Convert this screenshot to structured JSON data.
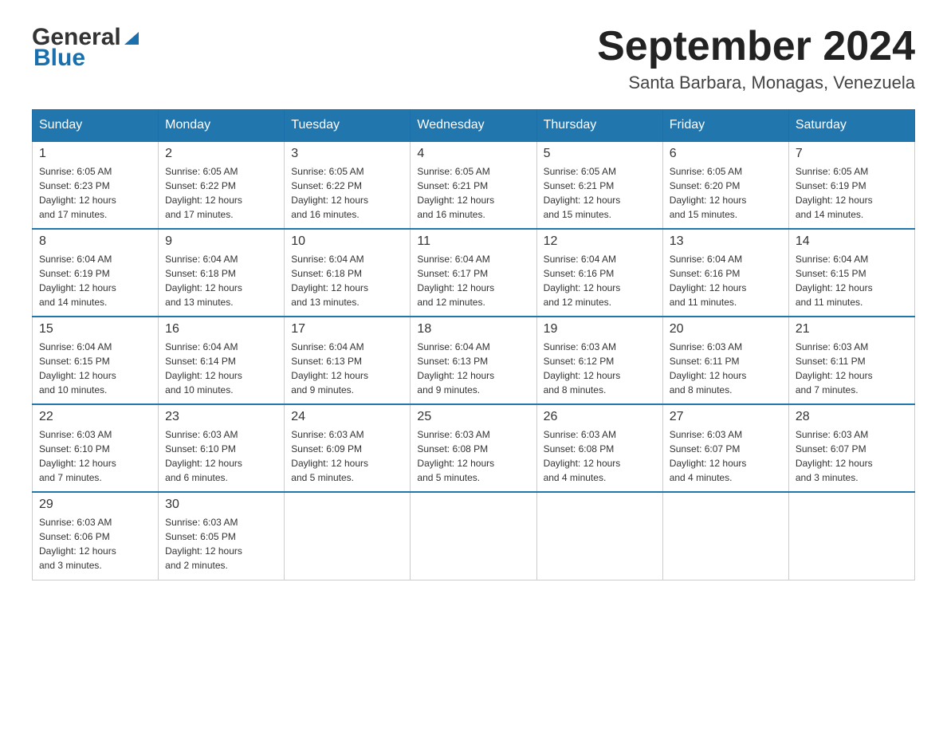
{
  "header": {
    "logo_general": "General",
    "logo_blue": "Blue",
    "title": "September 2024",
    "subtitle": "Santa Barbara, Monagas, Venezuela"
  },
  "days_of_week": [
    "Sunday",
    "Monday",
    "Tuesday",
    "Wednesday",
    "Thursday",
    "Friday",
    "Saturday"
  ],
  "weeks": [
    [
      {
        "day": "1",
        "sunrise": "6:05 AM",
        "sunset": "6:23 PM",
        "daylight": "12 hours and 17 minutes."
      },
      {
        "day": "2",
        "sunrise": "6:05 AM",
        "sunset": "6:22 PM",
        "daylight": "12 hours and 17 minutes."
      },
      {
        "day": "3",
        "sunrise": "6:05 AM",
        "sunset": "6:22 PM",
        "daylight": "12 hours and 16 minutes."
      },
      {
        "day": "4",
        "sunrise": "6:05 AM",
        "sunset": "6:21 PM",
        "daylight": "12 hours and 16 minutes."
      },
      {
        "day": "5",
        "sunrise": "6:05 AM",
        "sunset": "6:21 PM",
        "daylight": "12 hours and 15 minutes."
      },
      {
        "day": "6",
        "sunrise": "6:05 AM",
        "sunset": "6:20 PM",
        "daylight": "12 hours and 15 minutes."
      },
      {
        "day": "7",
        "sunrise": "6:05 AM",
        "sunset": "6:19 PM",
        "daylight": "12 hours and 14 minutes."
      }
    ],
    [
      {
        "day": "8",
        "sunrise": "6:04 AM",
        "sunset": "6:19 PM",
        "daylight": "12 hours and 14 minutes."
      },
      {
        "day": "9",
        "sunrise": "6:04 AM",
        "sunset": "6:18 PM",
        "daylight": "12 hours and 13 minutes."
      },
      {
        "day": "10",
        "sunrise": "6:04 AM",
        "sunset": "6:18 PM",
        "daylight": "12 hours and 13 minutes."
      },
      {
        "day": "11",
        "sunrise": "6:04 AM",
        "sunset": "6:17 PM",
        "daylight": "12 hours and 12 minutes."
      },
      {
        "day": "12",
        "sunrise": "6:04 AM",
        "sunset": "6:16 PM",
        "daylight": "12 hours and 12 minutes."
      },
      {
        "day": "13",
        "sunrise": "6:04 AM",
        "sunset": "6:16 PM",
        "daylight": "12 hours and 11 minutes."
      },
      {
        "day": "14",
        "sunrise": "6:04 AM",
        "sunset": "6:15 PM",
        "daylight": "12 hours and 11 minutes."
      }
    ],
    [
      {
        "day": "15",
        "sunrise": "6:04 AM",
        "sunset": "6:15 PM",
        "daylight": "12 hours and 10 minutes."
      },
      {
        "day": "16",
        "sunrise": "6:04 AM",
        "sunset": "6:14 PM",
        "daylight": "12 hours and 10 minutes."
      },
      {
        "day": "17",
        "sunrise": "6:04 AM",
        "sunset": "6:13 PM",
        "daylight": "12 hours and 9 minutes."
      },
      {
        "day": "18",
        "sunrise": "6:04 AM",
        "sunset": "6:13 PM",
        "daylight": "12 hours and 9 minutes."
      },
      {
        "day": "19",
        "sunrise": "6:03 AM",
        "sunset": "6:12 PM",
        "daylight": "12 hours and 8 minutes."
      },
      {
        "day": "20",
        "sunrise": "6:03 AM",
        "sunset": "6:11 PM",
        "daylight": "12 hours and 8 minutes."
      },
      {
        "day": "21",
        "sunrise": "6:03 AM",
        "sunset": "6:11 PM",
        "daylight": "12 hours and 7 minutes."
      }
    ],
    [
      {
        "day": "22",
        "sunrise": "6:03 AM",
        "sunset": "6:10 PM",
        "daylight": "12 hours and 7 minutes."
      },
      {
        "day": "23",
        "sunrise": "6:03 AM",
        "sunset": "6:10 PM",
        "daylight": "12 hours and 6 minutes."
      },
      {
        "day": "24",
        "sunrise": "6:03 AM",
        "sunset": "6:09 PM",
        "daylight": "12 hours and 5 minutes."
      },
      {
        "day": "25",
        "sunrise": "6:03 AM",
        "sunset": "6:08 PM",
        "daylight": "12 hours and 5 minutes."
      },
      {
        "day": "26",
        "sunrise": "6:03 AM",
        "sunset": "6:08 PM",
        "daylight": "12 hours and 4 minutes."
      },
      {
        "day": "27",
        "sunrise": "6:03 AM",
        "sunset": "6:07 PM",
        "daylight": "12 hours and 4 minutes."
      },
      {
        "day": "28",
        "sunrise": "6:03 AM",
        "sunset": "6:07 PM",
        "daylight": "12 hours and 3 minutes."
      }
    ],
    [
      {
        "day": "29",
        "sunrise": "6:03 AM",
        "sunset": "6:06 PM",
        "daylight": "12 hours and 3 minutes."
      },
      {
        "day": "30",
        "sunrise": "6:03 AM",
        "sunset": "6:05 PM",
        "daylight": "12 hours and 2 minutes."
      },
      null,
      null,
      null,
      null,
      null
    ]
  ]
}
